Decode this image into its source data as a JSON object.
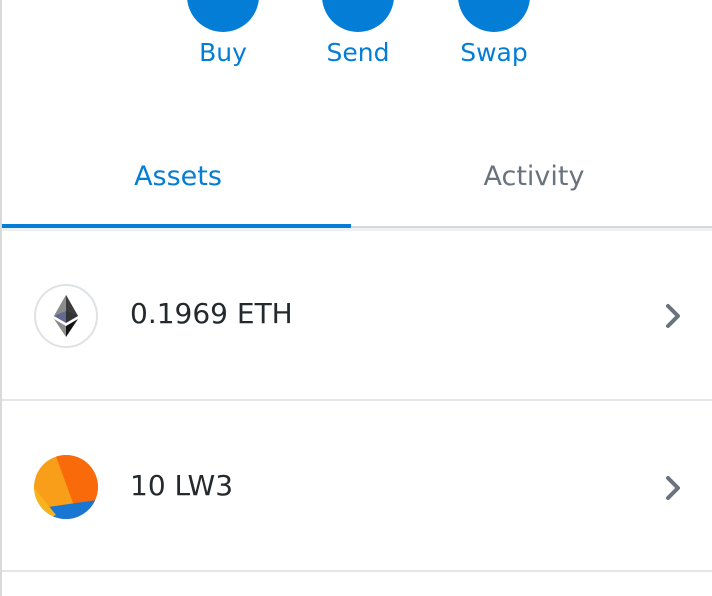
{
  "actions": {
    "buy_label": "Buy",
    "send_label": "Send",
    "swap_label": "Swap"
  },
  "tabs": {
    "assets_label": "Assets",
    "activity_label": "Activity",
    "active": "Assets"
  },
  "assets": [
    {
      "amount_label": "0.1969 ETH",
      "icon": "ethereum-icon"
    },
    {
      "amount_label": "10 LW3",
      "icon": "token-identicon"
    }
  ],
  "colors": {
    "accent": "#037dd6",
    "inactive_tab": "#6a737d",
    "text": "#24292e"
  }
}
